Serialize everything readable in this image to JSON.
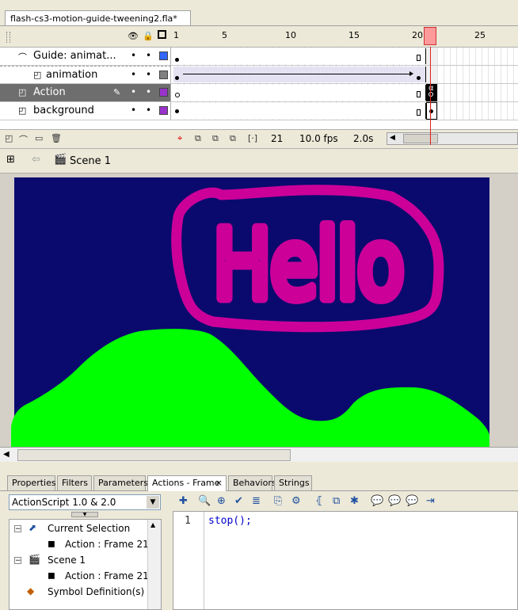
{
  "document": {
    "tab_title": "flash-cs3-motion-guide-tweening2.fla*"
  },
  "timeline": {
    "ruler_numbers": [
      "1",
      "5",
      "10",
      "15",
      "20",
      "25"
    ],
    "current_frame_marker": "21",
    "layers": [
      {
        "name": "Guide: animat...",
        "color": "#3366ff",
        "type": "guide"
      },
      {
        "name": "animation",
        "color": "#808080",
        "type": "guided"
      },
      {
        "name": "Action",
        "color": "#9933cc",
        "type": "normal",
        "selected": true
      },
      {
        "name": "background",
        "color": "#9933cc",
        "type": "normal"
      }
    ],
    "footer": {
      "current_frame": "21",
      "frame_rate": "10.0 fps",
      "elapsed_time": "2.0s"
    }
  },
  "editbar": {
    "scene_name": "Scene 1"
  },
  "stage": {
    "background_color": "#0a0a6e",
    "hello_text": "Hello",
    "hello_color": "#cc0099",
    "hill_color": "#00ff00"
  },
  "panel": {
    "tabs": [
      {
        "label": "Properties"
      },
      {
        "label": "Filters"
      },
      {
        "label": "Parameters"
      },
      {
        "label": "Actions - Frame"
      },
      {
        "label": "Behaviors"
      },
      {
        "label": "Strings"
      }
    ],
    "active_tab": "Actions - Frame",
    "actionscript_version": "ActionScript 1.0 & 2.0",
    "tree": {
      "current_selection": "Current Selection",
      "current_selection_child": "Action : Frame 21",
      "scene": "Scene 1",
      "scene_child": "Action : Frame 21",
      "symbol_definitions": "Symbol Definition(s)"
    },
    "code": {
      "line_number": "1",
      "line_text": "stop();"
    }
  }
}
